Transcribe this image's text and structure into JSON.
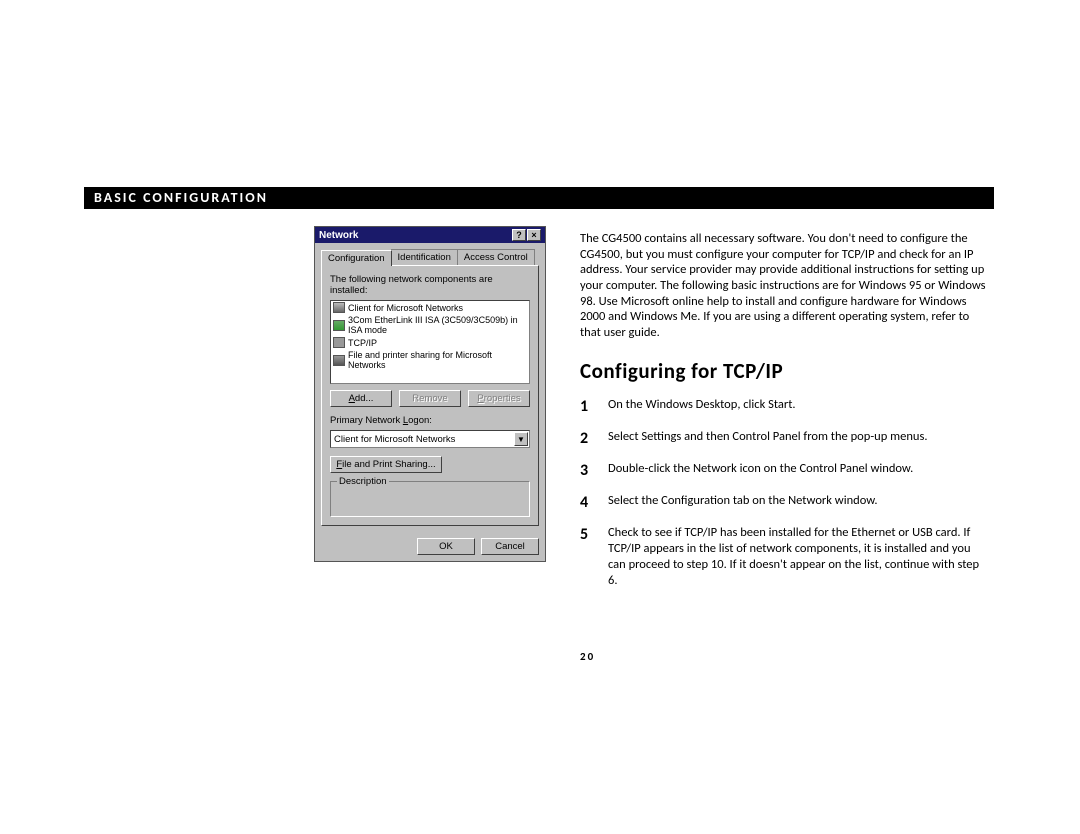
{
  "banner": "BASIC CONFIGURATION",
  "dialog": {
    "title": "Network",
    "help_glyph": "?",
    "close_glyph": "×",
    "tabs": [
      "Configuration",
      "Identification",
      "Access Control"
    ],
    "components_label": "The following network components are installed:",
    "components": [
      "Client for Microsoft Networks",
      "3Com EtherLink III ISA (3C509/3C509b) in ISA mode",
      "TCP/IP",
      "File and printer sharing for Microsoft Networks"
    ],
    "add_btn": "Add...",
    "remove_btn": "Remove",
    "properties_btn": "Properties",
    "primary_logon_label": "Primary Network Logon:",
    "primary_logon_value": "Client for Microsoft Networks",
    "file_print_btn": "File and Print Sharing...",
    "description_label": "Description",
    "ok_btn": "OK",
    "cancel_btn": "Cancel"
  },
  "intro": "The CG4500 contains all necessary software. You don't need to configure the CG4500, but you must configure your computer for TCP/IP and check for an IP address. Your service provider may provide additional instructions for setting up your computer. The following basic instructions are for Windows 95 or Windows 98. Use Microsoft online help to install and configure hardware for Windows 2000 and Windows Me. If you are using a different operating system, refer to that user guide.",
  "heading": "Configuring for TCP/IP",
  "steps": [
    "On the Windows Desktop, click Start.",
    "Select Settings and then Control Panel from the pop-up menus.",
    "Double-click the Network icon on the Control Panel window.",
    "Select the Configuration tab on the Network window.",
    "Check to see if TCP/IP has been installed for the Ethernet or USB card. If TCP/IP appears in the list of network components, it is installed and you can proceed to step 10. If it doesn't appear on the list, continue with step 6."
  ],
  "step_nums": [
    "1",
    "2",
    "3",
    "4",
    "5"
  ],
  "page_number": "20"
}
